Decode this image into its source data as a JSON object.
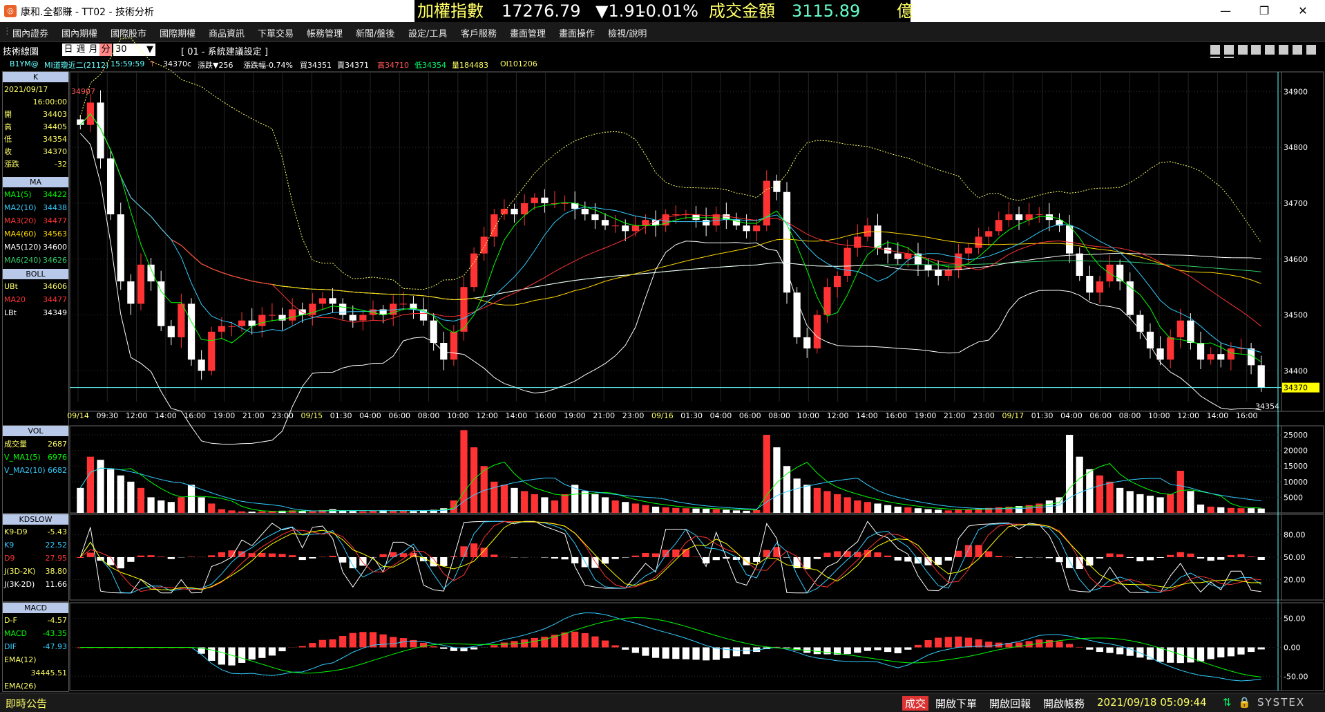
{
  "window": {
    "title": "康和.全都賺 - TT02 - 技術分析",
    "icon": "app-logo-icon"
  },
  "ticker": {
    "label": "加權指數",
    "value": "17276.79",
    "change": "▼1.91",
    "pct": "-0.01%",
    "amount_label": "成交金額",
    "amount": "3115.89",
    "unit": "億"
  },
  "menu": [
    "國內證券",
    "國內期權",
    "國際股市",
    "國際期權",
    "商品資訊",
    "下單交易",
    "帳務管理",
    "新聞/盤後",
    "設定/工具",
    "客戶服務",
    "畫面管理",
    "畫面操作",
    "檢視/說明"
  ],
  "toolbar": {
    "label": "技術線圖",
    "periods": [
      "日",
      "週",
      "月",
      "分"
    ],
    "period_value": "30",
    "preset": "[ 01 - 系統建議設定 ]"
  },
  "infobar": {
    "symbol": "B1YM@",
    "name": "MI道瓊近二(2112)",
    "time": "15:59:59",
    "mark": "↑",
    "close": "34370c",
    "chg": "漲跌▼256",
    "chg_pct": "漲跌幅-0.74%",
    "bid": "買34351",
    "ask": "賣34371",
    "high": "高34710",
    "low": "低34354",
    "vol": "量184483",
    "oi": "OI101206"
  },
  "k_panel": {
    "title": "K",
    "date": "2021/09/17",
    "time": "16:00:00",
    "rows": [
      [
        "開",
        "34403"
      ],
      [
        "高",
        "34405"
      ],
      [
        "低",
        "34354"
      ],
      [
        "收",
        "34370"
      ],
      [
        "漲跌",
        "-32"
      ]
    ]
  },
  "ma_panel": {
    "title": "MA",
    "rows": [
      [
        "MA1(5)",
        "34422"
      ],
      [
        "MA2(10)",
        "34438"
      ],
      [
        "MA3(20)",
        "34477"
      ],
      [
        "MA4(60)",
        "34563"
      ],
      [
        "MA5(120)",
        "34600"
      ],
      [
        "MA6(240)",
        "34626"
      ]
    ]
  },
  "boll_panel": {
    "title": "BOLL",
    "rows": [
      [
        "UBt",
        "34606"
      ],
      [
        "MA20",
        "34477"
      ],
      [
        "LBt",
        "34349"
      ]
    ]
  },
  "vol_panel": {
    "title": "VOL",
    "rows": [
      [
        "成交量",
        "2687"
      ],
      [
        "V_MA1(5)",
        "6976"
      ],
      [
        "V_MA2(10)",
        "6682"
      ]
    ]
  },
  "kd_panel": {
    "title": "KDSLOW",
    "rows": [
      [
        "K9-D9",
        "-5.43"
      ],
      [
        "K9",
        "22.52"
      ],
      [
        "D9",
        "27.95"
      ],
      [
        "J(3D-2K)",
        "38.80"
      ],
      [
        "J(3K-2D)",
        "11.66"
      ]
    ]
  },
  "macd_panel": {
    "title": "MACD",
    "rows": [
      [
        "D-F",
        "-4.57"
      ],
      [
        "MACD",
        "-43.35"
      ],
      [
        "DIF",
        "-47.93"
      ],
      [
        "EMA(12)",
        ""
      ],
      [
        "",
        "34445.51"
      ],
      [
        "EMA(26)",
        ""
      ]
    ]
  },
  "chart_data": {
    "type": "candlestick",
    "symbol": "B1YM@",
    "price_ticks": [
      "34900",
      "34800",
      "34700",
      "34600",
      "34500",
      "34400"
    ],
    "price_ylim": [
      34330,
      34930
    ],
    "price_markers": {
      "last": "34370",
      "low": "34354",
      "top_label": "34907"
    },
    "time_labels": [
      "09/14",
      "09:30",
      "12:00",
      "14:00",
      "16:00",
      "19:00",
      "21:00",
      "23:00",
      "09/15",
      "01:30",
      "04:00",
      "06:00",
      "08:00",
      "10:00",
      "12:00",
      "14:00",
      "16:00",
      "19:00",
      "21:00",
      "23:00",
      "09/16",
      "01:30",
      "04:00",
      "06:00",
      "08:00",
      "10:00",
      "12:00",
      "14:00",
      "16:00",
      "19:00",
      "21:00",
      "23:00",
      "09/17",
      "01:30",
      "04:00",
      "06:00",
      "08:00",
      "10:00",
      "12:00",
      "14:00",
      "16:00"
    ],
    "volume_ticks": [
      "25000",
      "20000",
      "15000",
      "10000",
      "5000"
    ],
    "kd_ticks": [
      "80.00",
      "50.00",
      "20.00"
    ],
    "macd_ticks": [
      "50.00",
      "0.00",
      "-50.00"
    ],
    "closes": [
      34840,
      34880,
      34780,
      34680,
      34560,
      34520,
      34590,
      34560,
      34480,
      34460,
      34520,
      34420,
      34400,
      34470,
      34480,
      34480,
      34490,
      34480,
      34500,
      34500,
      34490,
      34510,
      34500,
      34520,
      34530,
      34520,
      34500,
      34490,
      34500,
      34510,
      34500,
      34520,
      34520,
      34510,
      34490,
      34450,
      34420,
      34470,
      34550,
      34610,
      34640,
      34680,
      34690,
      34680,
      34700,
      34710,
      34700,
      34700,
      34700,
      34690,
      34680,
      34670,
      34660,
      34660,
      34650,
      34660,
      34670,
      34660,
      34680,
      34680,
      34680,
      34670,
      34660,
      34680,
      34670,
      34660,
      34650,
      34660,
      34740,
      34720,
      34540,
      34460,
      34440,
      34500,
      34550,
      34570,
      34620,
      34640,
      34660,
      34620,
      34610,
      34600,
      34610,
      34590,
      34580,
      34570,
      34580,
      34610,
      34620,
      34640,
      34650,
      34670,
      34680,
      34670,
      34680,
      34680,
      34670,
      34660,
      34610,
      34570,
      34540,
      34560,
      34590,
      34560,
      34500,
      34470,
      34440,
      34420,
      34460,
      34490,
      34450,
      34420,
      34430,
      34420,
      34440,
      34440,
      34410,
      34370
    ],
    "volumes": [
      8000,
      18000,
      17000,
      14000,
      12000,
      10000,
      8000,
      5000,
      4000,
      3500,
      5000,
      9000,
      5000,
      3000,
      1200,
      800,
      500,
      400,
      500,
      600,
      700,
      800,
      600,
      500,
      900,
      1200,
      700,
      600,
      500,
      700,
      900,
      800,
      700,
      600,
      800,
      1000,
      1500,
      4000,
      26500,
      21000,
      15000,
      10000,
      9000,
      8000,
      7000,
      6000,
      5000,
      4000,
      6000,
      9000,
      7000,
      6000,
      5000,
      4000,
      3500,
      3000,
      2500,
      2000,
      1800,
      1600,
      1500,
      1400,
      1300,
      1200,
      1000,
      800,
      700,
      900,
      25000,
      21000,
      15000,
      11000,
      9000,
      8000,
      7000,
      6000,
      5000,
      4000,
      3500,
      3000,
      2500,
      2000,
      1800,
      1500,
      1200,
      1000,
      800,
      1000,
      1200,
      1400,
      1600,
      1800,
      2000,
      2200,
      2500,
      3000,
      4000,
      5000,
      25000,
      18000,
      14000,
      12000,
      10000,
      8000,
      7000,
      6000,
      5500,
      5000,
      6000,
      13500,
      7000,
      2687,
      2000,
      1800,
      1600,
      1500,
      1500,
      1400,
      1300,
      1200
    ],
    "ma_colors": {
      "MA1": "#00ff00",
      "MA2": "#33ccff",
      "MA3": "#ff3333",
      "MA4": "#ffd700",
      "MA5": "#ffffff",
      "MA6": "#33cc66"
    }
  },
  "status": {
    "left": "即時公告",
    "buttons": [
      "成交",
      "開啟下單",
      "開啟回報",
      "開啟帳務"
    ],
    "datetime": "2021/09/18 05:09:44",
    "brand": "SYSTEX"
  }
}
